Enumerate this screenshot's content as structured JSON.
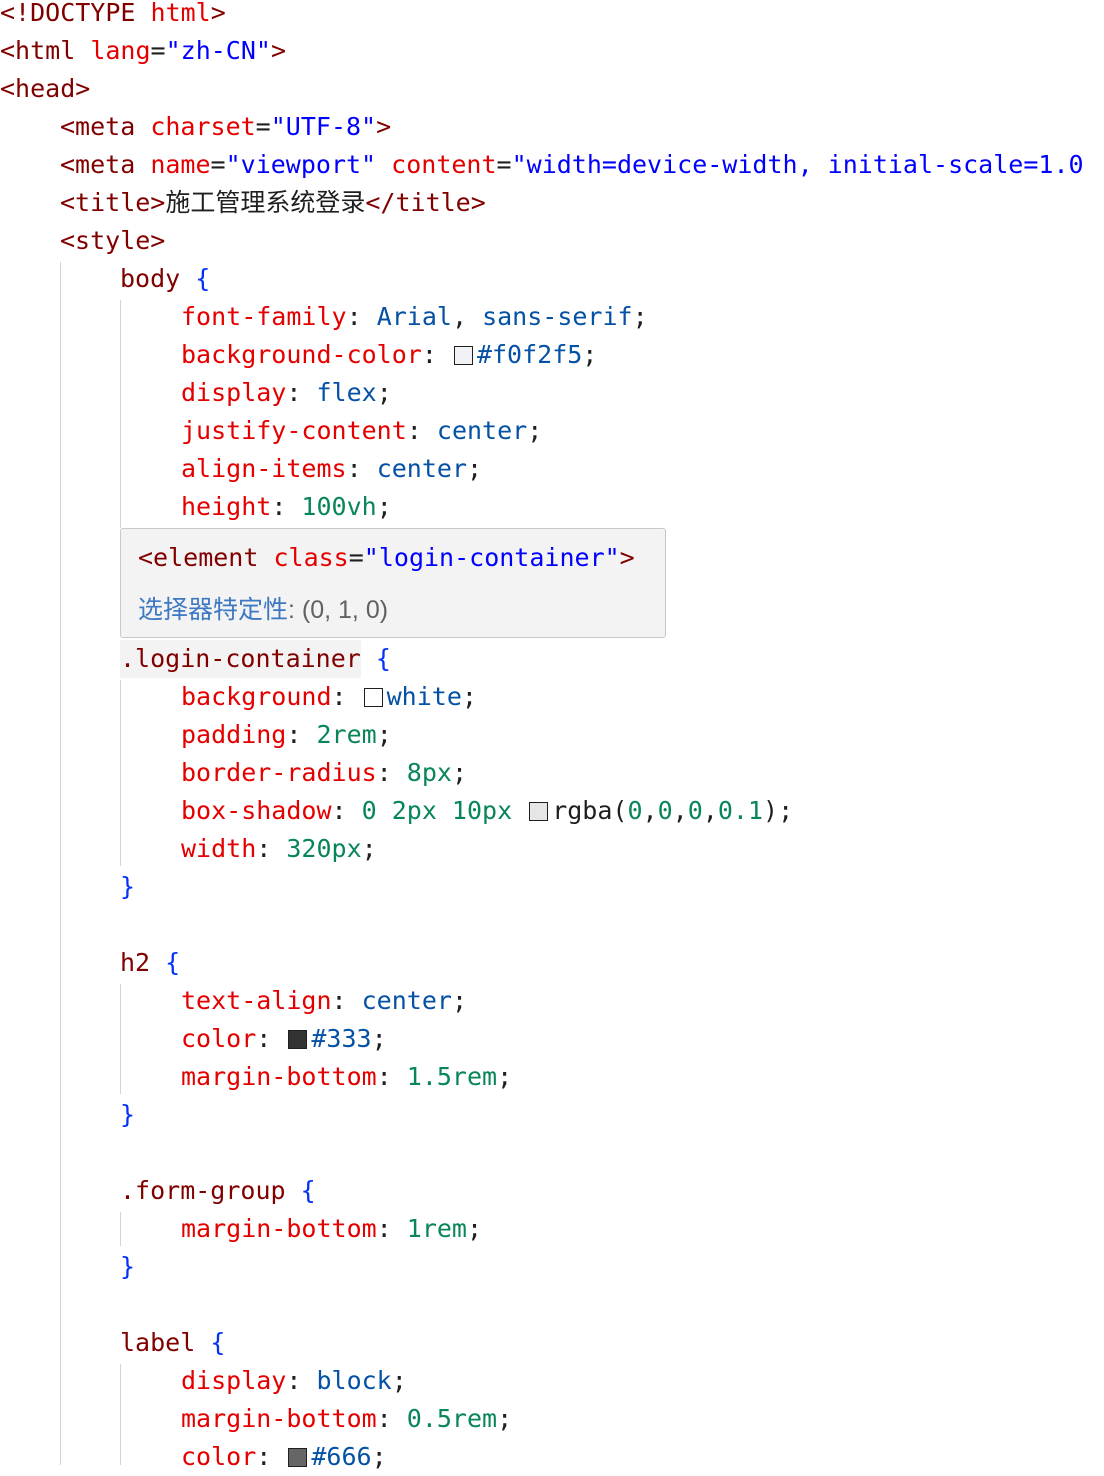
{
  "code_lines": [
    {
      "text": "<!DOCTYPE html>"
    },
    {
      "text": "<html lang=\"zh-CN\">"
    },
    {
      "text": "<head>"
    },
    {
      "text": "<meta charset=\"UTF-8\">"
    },
    {
      "text": "<meta name=\"viewport\" content=\"width=device-width, initial-scale=1.0"
    },
    {
      "text": "<title>施工管理系统登录</title>"
    },
    {
      "text": "<style>"
    },
    {
      "text": "body {"
    },
    {
      "text": "font-family: Arial, sans-serif;"
    },
    {
      "text": "background-color: #f0f2f5;"
    },
    {
      "text": "display: flex;"
    },
    {
      "text": "justify-content: center;"
    },
    {
      "text": "align-items: center;"
    },
    {
      "text": "height: 100vh;"
    },
    {
      "text": ".login-container {"
    },
    {
      "text": "background: white;"
    },
    {
      "text": "padding: 2rem;"
    },
    {
      "text": "border-radius: 8px;"
    },
    {
      "text": "box-shadow: 0 2px 10px rgba(0,0,0,0.1);"
    },
    {
      "text": "width: 320px;"
    },
    {
      "text": "}"
    },
    {
      "text": "h2 {"
    },
    {
      "text": "text-align: center;"
    },
    {
      "text": "color: #333;"
    },
    {
      "text": "margin-bottom: 1.5rem;"
    },
    {
      "text": "}"
    },
    {
      "text": ".form-group {"
    },
    {
      "text": "margin-bottom: 1rem;"
    },
    {
      "text": "}"
    },
    {
      "text": "label {"
    },
    {
      "text": "display: block;"
    },
    {
      "text": "margin-bottom: 0.5rem;"
    },
    {
      "text": "color: #666;"
    }
  ],
  "hover": {
    "element_line": "<element class=\"login-container\">",
    "specificity_label": "选择器特定性",
    "specificity_value": ": (0, 1, 0)"
  },
  "colors": {
    "background_swatch": "#f0f2f5",
    "white_swatch": "#ffffff",
    "shadow_swatch": "#e6e6e6",
    "h2_color_swatch": "#333333",
    "label_color_swatch": "#666666"
  }
}
